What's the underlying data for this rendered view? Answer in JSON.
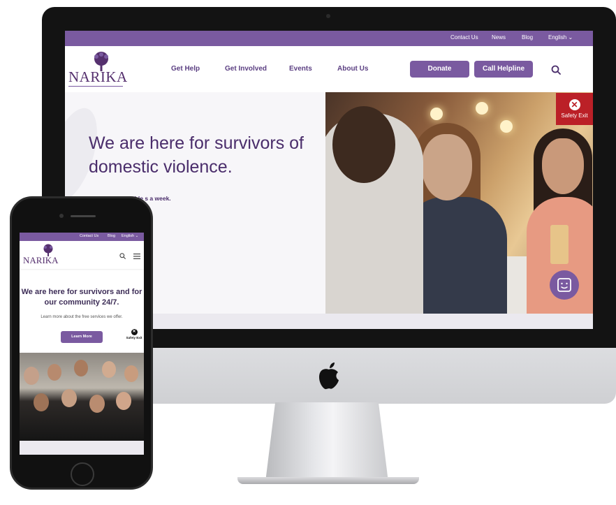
{
  "desktop": {
    "topbar": {
      "links": [
        "Contact Us",
        "News",
        "Blog",
        "English ⌄"
      ]
    },
    "logo": "NARIKA",
    "nav": [
      "Get Help",
      "Get Involved",
      "Events",
      "About Us"
    ],
    "donate_label": "Donate",
    "helpline_label": "Call Helpline",
    "hero_title": "We are here for survivors of domestic violence.",
    "hero_sub": "rvices are available s a week.",
    "safety_exit_label": "Safety Exit"
  },
  "mobile": {
    "topbar": {
      "links": [
        "Contact Us",
        "Blog",
        "English ⌄"
      ]
    },
    "logo": "NARIKA",
    "hero_title": "We are here for survivors and for our community 24/7.",
    "hero_sub": "Learn more about the free services we offer.",
    "learn_more_label": "Learn More",
    "safety_exit_label": "Safety Exit"
  },
  "colors": {
    "brand_purple": "#7a5aa0",
    "heading_purple": "#4a2d6b",
    "safety_red": "#bb2027"
  }
}
